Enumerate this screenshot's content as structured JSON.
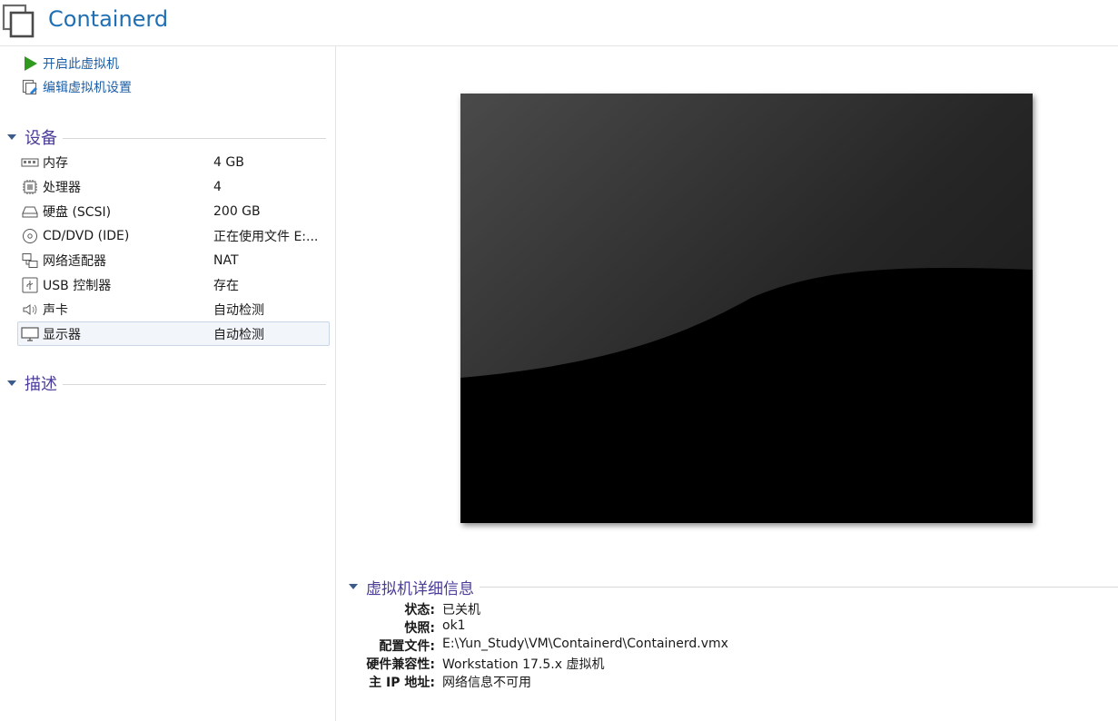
{
  "vm": {
    "title": "Containerd"
  },
  "actions": [
    {
      "label": "开启此虚拟机",
      "icon": "play-icon"
    },
    {
      "label": "编辑虚拟机设置",
      "icon": "edit-settings-icon"
    }
  ],
  "sections": {
    "devices": "设备",
    "description": "描述",
    "details": "虚拟机详细信息"
  },
  "devices": [
    {
      "name": "内存",
      "value": "4 GB",
      "icon": "memory-icon"
    },
    {
      "name": "处理器",
      "value": "4",
      "icon": "cpu-icon"
    },
    {
      "name": "硬盘 (SCSI)",
      "value": "200 GB",
      "icon": "harddisk-icon"
    },
    {
      "name": "CD/DVD (IDE)",
      "value": "正在使用文件 E:...",
      "icon": "cd-icon"
    },
    {
      "name": "网络适配器",
      "value": "NAT",
      "icon": "network-icon"
    },
    {
      "name": "USB 控制器",
      "value": "存在",
      "icon": "usb-icon"
    },
    {
      "name": "声卡",
      "value": "自动检测",
      "icon": "speaker-icon"
    },
    {
      "name": "显示器",
      "value": "自动检测",
      "icon": "monitor-icon",
      "selected": true
    }
  ],
  "details": [
    {
      "label": "状态:",
      "value": "已关机"
    },
    {
      "label": "快照:",
      "value": "ok1"
    },
    {
      "label": "配置文件:",
      "value": "E:\\Yun_Study\\VM\\Containerd\\Containerd.vmx"
    },
    {
      "label": "硬件兼容性:",
      "value": "Workstation 17.5.x 虚拟机"
    },
    {
      "label": "主 IP 地址:",
      "value": "网络信息不可用"
    }
  ],
  "colors": {
    "title": "#1f6fb4",
    "section": "#4b3c9a",
    "link": "#1c5fa8"
  }
}
